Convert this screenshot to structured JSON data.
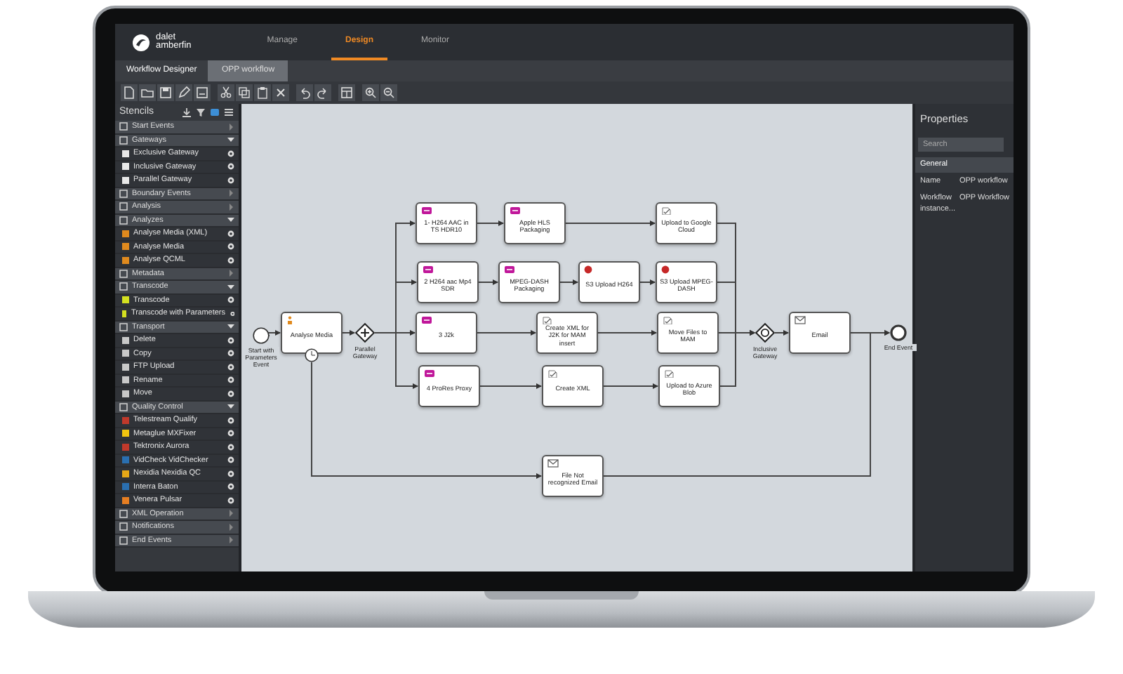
{
  "logo": {
    "line_1": "dalet",
    "line_2": "amberfin"
  },
  "nav_tabs": [
    {
      "label": "Manage",
      "selected": false
    },
    {
      "label": "Design",
      "selected": true
    },
    {
      "label": "Monitor",
      "selected": false
    }
  ],
  "doc_tabs": [
    {
      "label": "Workflow Designer",
      "selected": false
    },
    {
      "label": "OPP workflow",
      "selected": true
    }
  ],
  "stencils": {
    "title": "Stencils",
    "groups": [
      {
        "label": "Start Events",
        "expanded": false
      },
      {
        "label": "Gateways",
        "expanded": true,
        "children": [
          {
            "label": "Exclusive Gateway",
            "color": "#e8e8e8"
          },
          {
            "label": "Inclusive Gateway",
            "color": "#e8e8e8"
          },
          {
            "label": "Parallel Gateway",
            "color": "#e8e8e8"
          }
        ]
      },
      {
        "label": "Boundary Events",
        "expanded": false
      },
      {
        "label": "Analysis",
        "expanded": false
      },
      {
        "label": "Analyzes",
        "expanded": true,
        "children": [
          {
            "label": "Analyse Media (XML)",
            "color": "#e08a1e"
          },
          {
            "label": "Analyse Media",
            "color": "#e08a1e"
          },
          {
            "label": "Analyse QCML",
            "color": "#e08a1e"
          }
        ]
      },
      {
        "label": "Metadata",
        "expanded": false
      },
      {
        "label": "Transcode",
        "expanded": true,
        "children": [
          {
            "label": "Transcode",
            "color": "#d4e020"
          },
          {
            "label": "Transcode with Parameters",
            "color": "#d4e020"
          }
        ]
      },
      {
        "label": "Transport",
        "expanded": true,
        "children": [
          {
            "label": "Delete",
            "color": "#c8c8c8"
          },
          {
            "label": "Copy",
            "color": "#c8c8c8"
          },
          {
            "label": "FTP Upload",
            "color": "#c8c8c8"
          },
          {
            "label": "Rename",
            "color": "#c8c8c8"
          },
          {
            "label": "Move",
            "color": "#c8c8c8"
          }
        ]
      },
      {
        "label": "Quality Control",
        "expanded": true,
        "children": [
          {
            "label": "Telestream Qualify",
            "color": "#c0392b"
          },
          {
            "label": "Metaglue MXFixer",
            "color": "#f1c40f"
          },
          {
            "label": "Tektronix Aurora",
            "color": "#c0392b"
          },
          {
            "label": "VidCheck VidChecker",
            "color": "#2a6fb0"
          },
          {
            "label": "Nexidia Nexidia QC",
            "color": "#e6a817"
          },
          {
            "label": "Interra Baton",
            "color": "#2a6fb0"
          },
          {
            "label": "Venera Pulsar",
            "color": "#e67e22"
          }
        ]
      },
      {
        "label": "XML Operation",
        "expanded": false
      },
      {
        "label": "Notifications",
        "expanded": false
      },
      {
        "label": "End Events",
        "expanded": false
      }
    ]
  },
  "diagram": {
    "nodes": [
      {
        "kind": "start",
        "label": "Start with Parameters Event"
      },
      {
        "kind": "task",
        "label": "Analyse Media"
      },
      {
        "kind": "timer"
      },
      {
        "kind": "parallel_gateway",
        "label": "Parallel Gateway"
      },
      {
        "kind": "task",
        "label": "1- H264 AAC in TS HDR10"
      },
      {
        "kind": "task",
        "label": "Apple HLS Packaging"
      },
      {
        "kind": "task",
        "label": "Upload to Google Cloud"
      },
      {
        "kind": "task",
        "label": "2 H264 aac Mp4 SDR"
      },
      {
        "kind": "task",
        "label": "MPEG-DASH Packaging"
      },
      {
        "kind": "task",
        "label": "S3 Upload H264"
      },
      {
        "kind": "task",
        "label": "S3 Upload MPEG-DASH"
      },
      {
        "kind": "task",
        "label": "3 J2k"
      },
      {
        "kind": "task",
        "label": "Create XML for J2K for MAM insert"
      },
      {
        "kind": "task",
        "label": "Move Files to MAM"
      },
      {
        "kind": "task",
        "label": "4 ProRes Proxy"
      },
      {
        "kind": "task",
        "label": "Create XML"
      },
      {
        "kind": "task",
        "label": "Upload to Azure Blob"
      },
      {
        "kind": "inclusive_gateway",
        "label": "Inclusive Gateway"
      },
      {
        "kind": "task",
        "label": "Email"
      },
      {
        "kind": "end",
        "label": "End Event"
      },
      {
        "kind": "task",
        "label": "File Not recognized Email"
      }
    ]
  },
  "properties": {
    "title": "Properties",
    "search": {
      "placeholder": "Search"
    },
    "section": "General",
    "rows": [
      {
        "name": "Name",
        "value": "OPP workflow"
      },
      {
        "name": "Workflow instance...",
        "value": "OPP Workflow"
      }
    ]
  }
}
